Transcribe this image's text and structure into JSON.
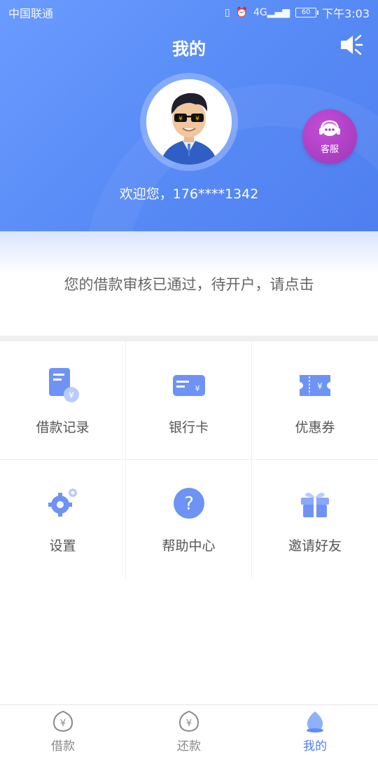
{
  "status_bar": {
    "carrier": "中国联通",
    "signal": "4G",
    "battery": "60",
    "time": "下午3:03"
  },
  "header": {
    "title": "我的",
    "welcome": "欢迎您，176****1342",
    "service_label": "客服"
  },
  "notice": "您的借款审核已通过，待开户，请点击",
  "menu": [
    {
      "label": "借款记录",
      "icon": "loan-record-icon"
    },
    {
      "label": "银行卡",
      "icon": "bank-card-icon"
    },
    {
      "label": "优惠券",
      "icon": "coupon-icon"
    },
    {
      "label": "设置",
      "icon": "settings-icon"
    },
    {
      "label": "帮助中心",
      "icon": "help-icon"
    },
    {
      "label": "邀请好友",
      "icon": "gift-icon"
    }
  ],
  "tabs": [
    {
      "label": "借款",
      "icon": "loan-icon"
    },
    {
      "label": "还款",
      "icon": "repay-icon"
    },
    {
      "label": "我的",
      "icon": "profile-icon",
      "active": true
    }
  ],
  "colors": {
    "primary": "#4f7ff0",
    "header_gradient_start": "#6a9bff",
    "service_purple": "#b142c9"
  }
}
